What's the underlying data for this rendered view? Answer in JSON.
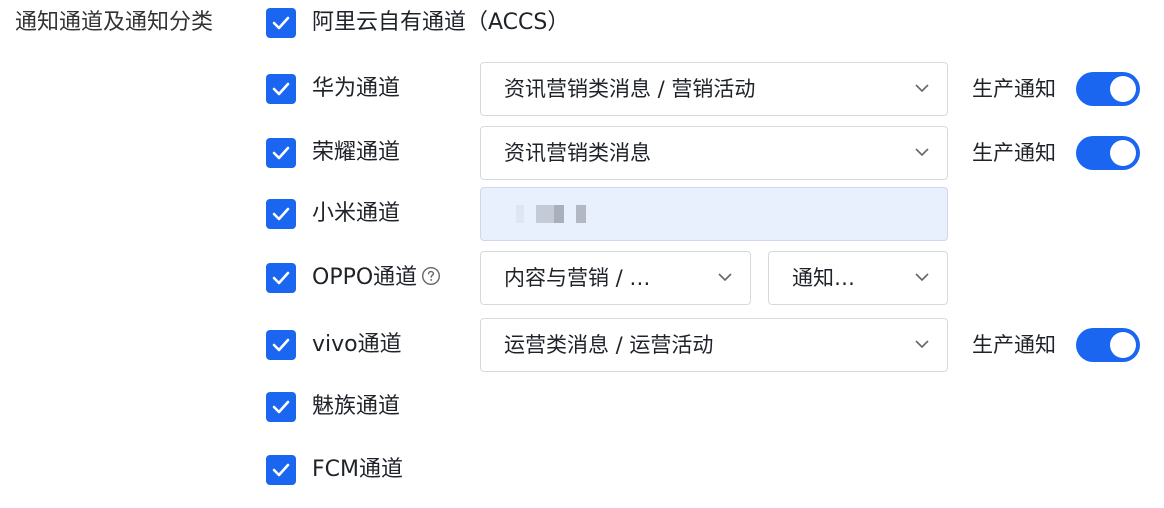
{
  "section": {
    "label": "通知通道及通知分类"
  },
  "colors": {
    "accent": "#1a66f0",
    "border": "#d6d9de",
    "disabled_bg": "#e8f0fd"
  },
  "channels": [
    {
      "id": "accs",
      "label": "阿里云自有通道（ACCS）",
      "checked": true
    },
    {
      "id": "huawei",
      "label": "华为通道",
      "checked": true,
      "select": {
        "value": "资讯营销类消息 / 营销活动"
      },
      "toggle": {
        "label": "生产通知",
        "on": true
      }
    },
    {
      "id": "honor",
      "label": "荣耀通道",
      "checked": true,
      "select": {
        "value": "资讯营销类消息"
      },
      "toggle": {
        "label": "生产通知",
        "on": true
      }
    },
    {
      "id": "xiaomi",
      "label": "小米通道",
      "checked": true,
      "field": {
        "state": "blurred"
      }
    },
    {
      "id": "oppo",
      "label": "OPPO通道",
      "checked": true,
      "help_icon": "question-circle-icon",
      "select": {
        "value": "内容与营销 / …"
      },
      "select2": {
        "value": "通知…"
      }
    },
    {
      "id": "vivo",
      "label": "vivo通道",
      "checked": true,
      "select": {
        "value": "运营类消息 / 运营活动"
      },
      "toggle": {
        "label": "生产通知",
        "on": true
      }
    },
    {
      "id": "meizu",
      "label": "魅族通道",
      "checked": true
    },
    {
      "id": "fcm",
      "label": "FCM通道",
      "checked": true
    }
  ]
}
